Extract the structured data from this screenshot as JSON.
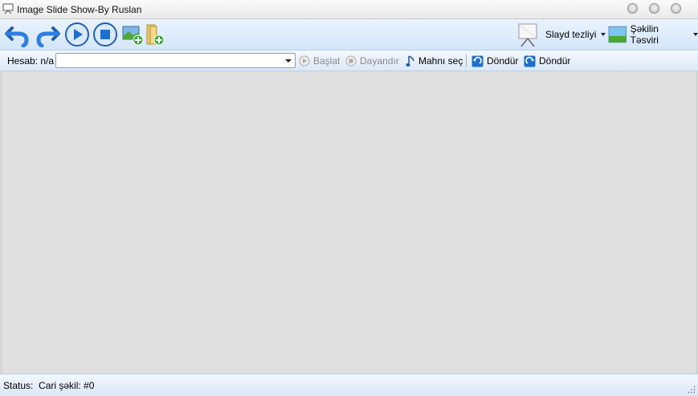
{
  "window": {
    "title": "Image Slide Show-By Ruslan"
  },
  "toolbar": {
    "undo": "undo-icon",
    "redo": "redo-icon",
    "play": "play-icon",
    "stop": "stop-icon",
    "add_image": "add-image-icon",
    "add_folder": "add-folder-icon",
    "slide_speed_label": "Slayd tezliyi",
    "image_description_label": "Şəkilin Təsviri"
  },
  "toolbar2": {
    "account_label": "Hesab: n/a",
    "account_value": "",
    "start_label": "Başlat",
    "stop_label": "Dayandır",
    "select_song_label": "Mahnı seç",
    "rotate_left_label": "Döndür",
    "rotate_right_label": "Döndür"
  },
  "status": {
    "label": "Status:",
    "value": "Cari şəkil: #0"
  },
  "colors": {
    "accent_blue": "#1e6fd0",
    "toolbar_bg": "#d4e6fa",
    "canvas_bg": "#e0e0e0"
  }
}
